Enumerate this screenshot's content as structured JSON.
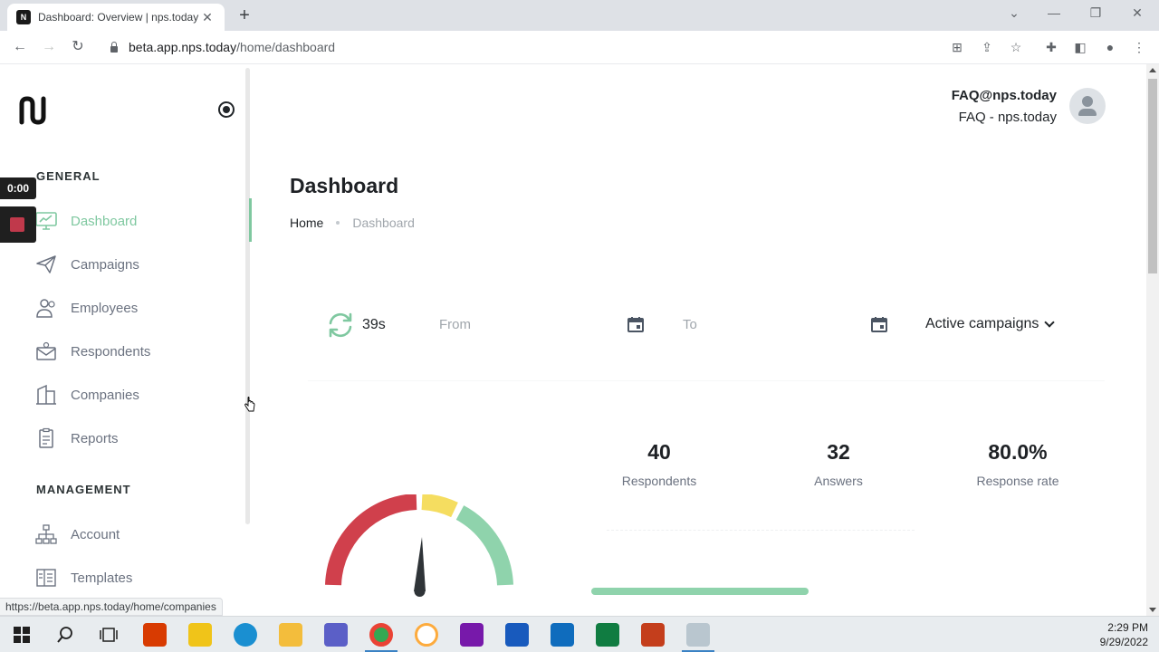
{
  "browser": {
    "tab_title": "Dashboard: Overview | nps.today",
    "favicon_text": "N",
    "tab_close": "✕",
    "new_tab": "+",
    "url_host": "beta.app.nps.today",
    "url_path": "/home/dashboard",
    "status_url": "https://beta.app.nps.today/home/companies"
  },
  "sidebar": {
    "general_heading": "GENERAL",
    "management_heading": "MANAGEMENT",
    "items": [
      {
        "label": "Dashboard"
      },
      {
        "label": "Campaigns"
      },
      {
        "label": "Employees"
      },
      {
        "label": "Respondents"
      },
      {
        "label": "Companies"
      },
      {
        "label": "Reports"
      }
    ],
    "management_items": [
      {
        "label": "Account"
      },
      {
        "label": "Templates"
      }
    ]
  },
  "recorder": {
    "time": "0:00"
  },
  "header": {
    "user_email": "FAQ@nps.today",
    "user_org": "FAQ - nps.today"
  },
  "page": {
    "title": "Dashboard",
    "breadcrumb_home": "Home",
    "breadcrumb_current": "Dashboard"
  },
  "filters": {
    "refresh_countdown": "39s",
    "from_placeholder": "From",
    "to_placeholder": "To",
    "campaign_select": "Active campaigns"
  },
  "stats": {
    "respondents_value": "40",
    "respondents_label": "Respondents",
    "answers_value": "32",
    "answers_label": "Answers",
    "rate_value": "80.0%",
    "rate_label": "Response rate",
    "response_rate_fraction": 0.8
  },
  "colors": {
    "accent": "#7fc8a0",
    "gauge_red": "#d0404c",
    "gauge_yellow": "#f5dd60",
    "gauge_green": "#8fd3ac",
    "gauge_needle": "#2f3438"
  },
  "taskbar": {
    "time": "2:29 PM",
    "date": "9/29/2022"
  }
}
